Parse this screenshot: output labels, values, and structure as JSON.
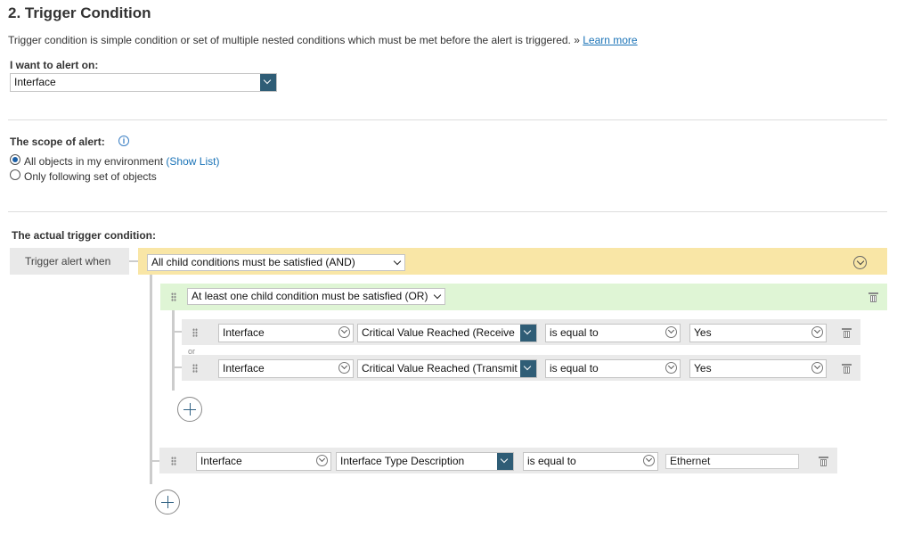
{
  "header": {
    "title": "2. Trigger Condition",
    "description": "Trigger condition is simple condition or set of multiple nested conditions which must be met before the alert is triggered. » ",
    "learn_more": "Learn more"
  },
  "alert_on": {
    "label": "I want to alert on:",
    "value": "Interface"
  },
  "scope": {
    "label": "The scope of alert:",
    "options": [
      {
        "label": "All objects in my environment",
        "link": "(Show List)",
        "selected": true
      },
      {
        "label": "Only following set of objects",
        "selected": false
      }
    ]
  },
  "trigger": {
    "label": "The actual trigger condition:",
    "when_label": "Trigger alert when",
    "root_condition": "All child conditions must be satisfied (AND)",
    "group_condition": "At least one child condition must be satisfied (OR)",
    "or_label": "or",
    "rows": [
      {
        "object": "Interface",
        "field": "Critical Value Reached (Receive",
        "operator": "is equal to",
        "value": "Yes"
      },
      {
        "object": "Interface",
        "field": "Critical Value Reached (Transmit",
        "operator": "is equal to",
        "value": "Yes"
      }
    ],
    "bottom_row": {
      "object": "Interface",
      "field": "Interface Type Description",
      "operator": "is equal to",
      "value": "Ethernet"
    }
  },
  "colors": {
    "and_band": "#f9e6a6",
    "or_band": "#dff5d5",
    "row_band": "#eaeaea",
    "dropdown_accent": "#2f5d76",
    "link": "#1a73b7"
  }
}
